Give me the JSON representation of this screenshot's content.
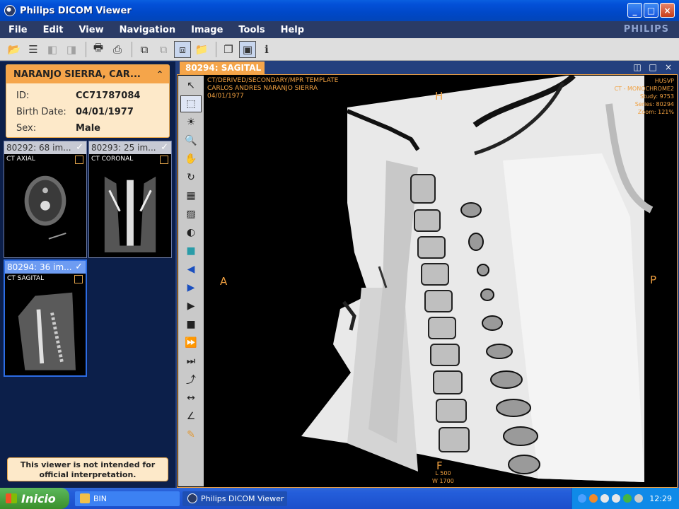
{
  "window": {
    "title": "Philips DICOM Viewer"
  },
  "menu": {
    "items": [
      "File",
      "Edit",
      "View",
      "Navigation",
      "Image",
      "Tools",
      "Help"
    ],
    "brand": "PHILIPS"
  },
  "patient": {
    "name": "NARANJO SIERRA, CAR...",
    "fields": [
      {
        "label": "ID:",
        "value": "CC71787084"
      },
      {
        "label": "Birth Date:",
        "value": "04/01/1977"
      },
      {
        "label": "Sex:",
        "value": "Male"
      }
    ]
  },
  "series": [
    {
      "title": "80292: 68 im...",
      "label": "CT AXIAL",
      "selected": false
    },
    {
      "title": "80293: 25 im...",
      "label": "CT CORONAL",
      "selected": false
    },
    {
      "title": "80294: 36 im...",
      "label": "CT SAGITAL",
      "selected": true
    }
  ],
  "notice": "This viewer is not intended for official interpretation.",
  "viewer": {
    "tab": "80294: SAGITAL",
    "info_tl": [
      "CT/DERIVED/SECONDARY/MPR TEMPLATE",
      "CARLOS ANDRES NARANJO SIERRA",
      "04/01/1977"
    ],
    "info_tr": [
      "HUSVP",
      "CT - MONOCHROME2",
      "Study: 9753",
      "Series: 80294",
      "Zoom: 121%"
    ],
    "orientation": {
      "top": "H",
      "left": "A",
      "right": "P",
      "bottom": "F"
    },
    "window_level": [
      "L 500",
      "W 1700"
    ]
  },
  "taskbar": {
    "start": "Inicio",
    "tasks": [
      {
        "label": "BIN"
      },
      {
        "label": "Philips DICOM Viewer"
      }
    ],
    "clock": "12:29"
  },
  "colors": {
    "accent": "#f5a54a",
    "panel": "#0c1f4a",
    "menubar": "#2a3b66"
  }
}
